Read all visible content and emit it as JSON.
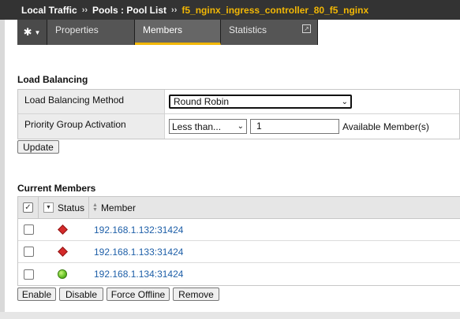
{
  "breadcrumb": {
    "section": "Local Traffic",
    "separator": "››",
    "page": "Pools : Pool List",
    "current": "f5_nginx_ingress_controller_80_f5_nginx"
  },
  "tabs": {
    "gear_icon": "gear-icon",
    "items": [
      {
        "label": "Properties"
      },
      {
        "label": "Members"
      },
      {
        "label": "Statistics"
      }
    ],
    "active": "Members"
  },
  "load_balancing": {
    "title": "Load Balancing",
    "method_label": "Load Balancing Method",
    "method_value": "Round Robin",
    "priority_label": "Priority Group Activation",
    "priority_select": "Less than...",
    "priority_value": "1",
    "available_members_label": "Available Member(s)",
    "update_button": "Update"
  },
  "members": {
    "title": "Current Members",
    "columns": {
      "status": "Status",
      "member": "Member"
    },
    "rows": [
      {
        "status": "offline",
        "status_icon": "red-diamond",
        "member": "192.168.1.132:31424"
      },
      {
        "status": "offline",
        "status_icon": "red-diamond",
        "member": "192.168.1.133:31424"
      },
      {
        "status": "available",
        "status_icon": "green-circle",
        "member": "192.168.1.134:31424"
      }
    ],
    "actions": {
      "enable": "Enable",
      "disable": "Disable",
      "force_offline": "Force Offline",
      "remove": "Remove"
    }
  },
  "colors": {
    "breadcrumb_bg": "#333333",
    "breadcrumb_current": "#f2b705",
    "tab_active_underline": "#f2b705",
    "link": "#1e5fa8",
    "status_offline": "#d42a2a",
    "status_available": "#6ac42a"
  }
}
